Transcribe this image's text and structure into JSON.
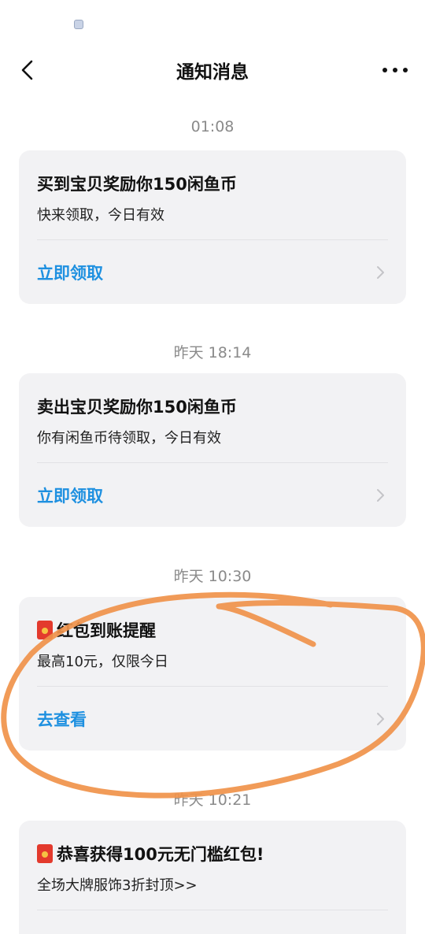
{
  "nav": {
    "title": "通知消息"
  },
  "messages": [
    {
      "time": "01:08",
      "title": "买到宝贝奖励你150闲鱼币",
      "subtitle": "快来领取，今日有效",
      "action": "立即领取",
      "has_redpacket_icon": false
    },
    {
      "time": "昨天 18:14",
      "title": "卖出宝贝奖励你150闲鱼币",
      "subtitle": "你有闲鱼币待领取，今日有效",
      "action": "立即领取",
      "has_redpacket_icon": false
    },
    {
      "time": "昨天 10:30",
      "title": "红包到账提醒",
      "subtitle": "最高10元，仅限今日",
      "action": "去查看",
      "has_redpacket_icon": true
    },
    {
      "time": "昨天 10:21",
      "title": "恭喜获得100元无门槛红包!",
      "subtitle": "全场大牌服饰3折封顶>>",
      "has_redpacket_icon": true
    }
  ],
  "colors": {
    "accent": "#1e90e0",
    "card_bg": "#f2f2f4",
    "time_text": "#8a8a8a",
    "annotation": "#f0924a",
    "redpacket": "#e33a2d"
  }
}
